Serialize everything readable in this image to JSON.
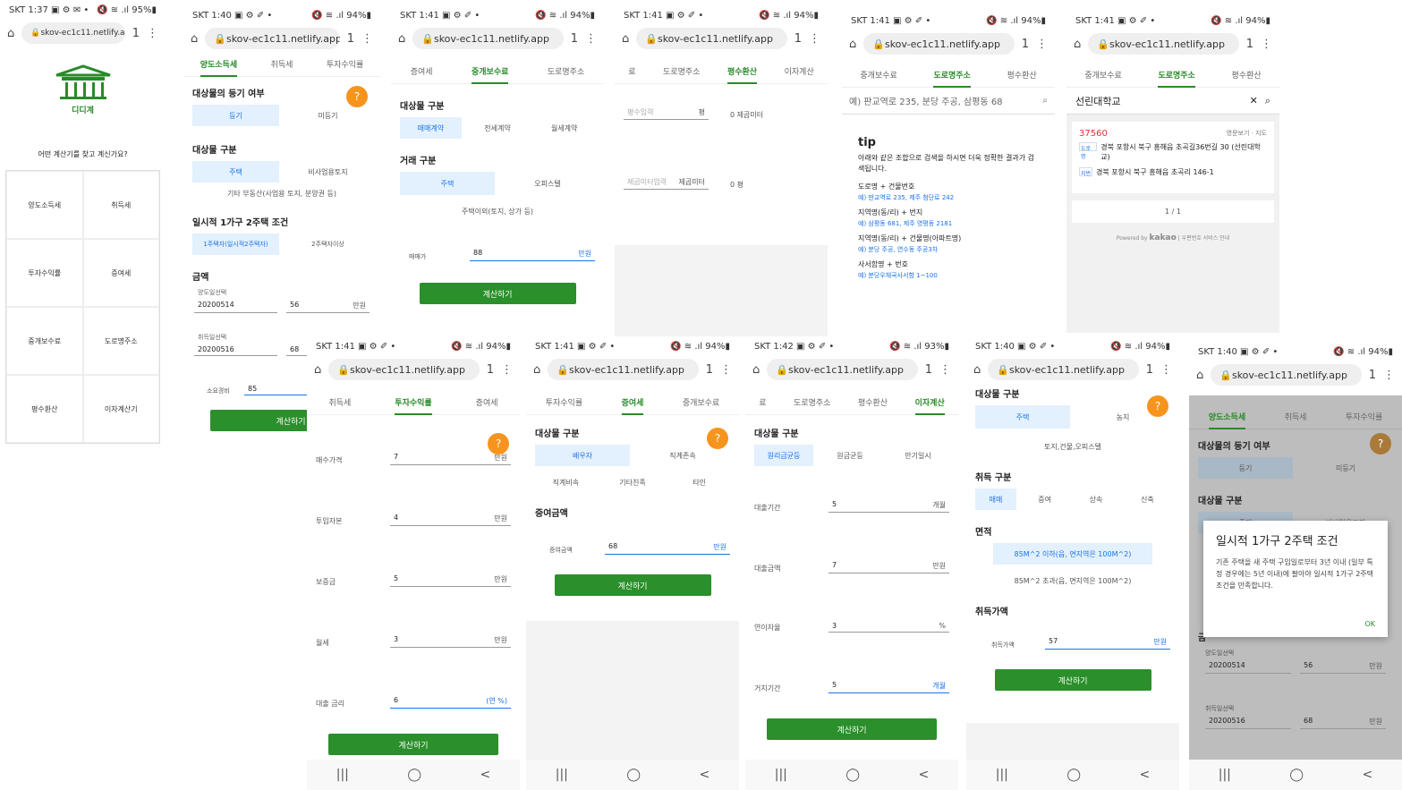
{
  "url": "skov-ec1c11.netlify.app",
  "tab_count": "1",
  "p1": {
    "status": "SKT 1:37 ▣ ⚙ ✉ •",
    "status_r": "🔇 ≋ .ıl 95%▮",
    "logo": "디디계",
    "question": "어떤 계산기를 찾고 계신가요?",
    "menu": [
      "양도소득세",
      "취득세",
      "투자수익률",
      "증여세",
      "중개보수료",
      "도로명주소",
      "평수환산",
      "이자계산기"
    ]
  },
  "p2": {
    "status": "SKT 1:40 ▣ ⚙ ✐ •",
    "status_r": "🔇 ≋ .ıl 94%▮",
    "tabs": [
      "양도소득세",
      "취득세",
      "투자수익률"
    ],
    "s1": "대상물의 등기 여부",
    "o1": [
      "등기",
      "미등기"
    ],
    "s2": "대상물 구분",
    "o2": [
      "주택",
      "비사업용토지"
    ],
    "o2b": "기타 부동산(사업용 토지, 분양권 등)",
    "s3": "일시적 1가구 2주택 조건",
    "o3": [
      "1주택자(일시적2주택자)",
      "2주택자이상"
    ],
    "s4": "금액",
    "l1": "양도일선택",
    "d1": "20200514",
    "v1": "56",
    "u": "만원",
    "l2": "취득일선택",
    "d2": "20200516",
    "v2": "68",
    "l3": "소요경비",
    "v3": "85",
    "btn": "계산하기",
    "fab": "?"
  },
  "p3": {
    "status": "SKT 1:41 ▣ ⚙ ✐ •",
    "status_r": "🔇 ≋ .ıl 94%▮",
    "tabs": [
      "증여세",
      "중개보수료",
      "도로명주소"
    ],
    "s1": "대상물 구분",
    "o1": [
      "매매계약",
      "전세계약",
      "월세계약"
    ],
    "s2": "거래 구분",
    "o2": [
      "주택",
      "오피스텔"
    ],
    "o2b": "주택이외(토지, 상가 등)",
    "l1": "매매가",
    "v1": "88",
    "u": "만원",
    "btn": "계산하기"
  },
  "p4": {
    "status": "SKT 1:41 ▣ ⚙ ✐ •",
    "status_r": "🔇 ≋ .ıl 94%▮",
    "tabs": [
      "료",
      "도로명주소",
      "평수환산",
      "이자계산"
    ],
    "l1": "평수입력",
    "u1": "평",
    "r1": "0 제곱미터",
    "l2": "제곱미터입력",
    "u2": "제곱미터",
    "r2": "0 평"
  },
  "p5": {
    "status": "SKT 1:41 ▣ ⚙ ✐ •",
    "status_r": "🔇 ≋ .ıl 94%▮",
    "tabs": [
      "중개보수료",
      "도로명주소",
      "평수환산"
    ],
    "search": "예) 판교역로 235, 분당 주공, 삼평동 68",
    "tip": "tip",
    "desc": "아래와 같은 조합으로 검색을 하시면 더욱 정확한 결과가 검색됩니다.",
    "items": [
      [
        "도로명 + 건물번호",
        "예) 판교역로 235, 제주 첨단로 242"
      ],
      [
        "지역명(동/리) + 번지",
        "예) 삼평동 681, 제주 영평동 2181"
      ],
      [
        "지역명(동/리) + 건물명(아파트명)",
        "예) 분당 주공, 연수동 주공3차"
      ],
      [
        "사서함명 + 번호",
        "예) 분당우체국사서함 1~100"
      ]
    ]
  },
  "p6": {
    "status": "SKT 1:41 ▣ ⚙ ✐ •",
    "status_r": "🔇 ≋ .ıl 94%▮",
    "tabs": [
      "중개보수료",
      "도로명주소",
      "평수환산"
    ],
    "query": "선린대학교",
    "zip": "37560",
    "links": "영문보기 · 지도",
    "tag1": "도로명",
    "addr1": "경북 포항시 북구 흥해읍 초곡길36번길 30 (선린대학교)",
    "tag2": "지번",
    "addr2": "경북 포항시 북구 흥해읍 초곡리 146-1",
    "page": "1 / 1",
    "powered": "Powered by",
    "kakao": "kakao",
    "guide": "우편번호 서비스 안내"
  },
  "p7": {
    "status": "SKT 1:41 ▣ ⚙ ✐ •",
    "status_r": "🔇 ≋ .ıl 94%▮",
    "tabs": [
      "취득세",
      "투자수익률",
      "증여세"
    ],
    "rows": [
      [
        "매수가격",
        "7",
        "만원"
      ],
      [
        "투입자본",
        "4",
        "만원"
      ],
      [
        "보증금",
        "5",
        "만원"
      ],
      [
        "월세",
        "3",
        "만원"
      ],
      [
        "대출 금리",
        "6",
        "(연 %)"
      ]
    ],
    "btn": "계산하기",
    "fab": "?"
  },
  "p8": {
    "status": "SKT 1:41 ▣ ⚙ ✐ •",
    "status_r": "🔇 ≋ .ıl 94%▮",
    "tabs": [
      "투자수익률",
      "증여세",
      "중개보수료"
    ],
    "s1": "대상물 구분",
    "o1": [
      "배우자",
      "직계존속"
    ],
    "o1b": [
      "직계비속",
      "기타친족",
      "타인"
    ],
    "s2": "증여금액",
    "l1": "증여금액",
    "v1": "68",
    "u": "만원",
    "btn": "계산하기",
    "fab": "?"
  },
  "p9": {
    "status": "SKT 1:42 ▣ ⚙ ✐ •",
    "status_r": "🔇 ≋ .ıl 93%▮",
    "tabs": [
      "료",
      "도로명주소",
      "평수환산",
      "이자계산"
    ],
    "s1": "대상물 구분",
    "o1": [
      "원리금균등",
      "원금균등",
      "만기일시"
    ],
    "rows": [
      [
        "대출기간",
        "5",
        "개월"
      ],
      [
        "대출금액",
        "7",
        "만원"
      ],
      [
        "연이자율",
        "3",
        "%"
      ],
      [
        "거치기간",
        "5",
        "개월"
      ]
    ],
    "btn": "계산하기"
  },
  "p10": {
    "status": "SKT 1:40 ▣ ⚙ ✐ •",
    "status_r": "🔇 ≋ .ıl 94%▮",
    "s1": "대상물 구분",
    "o1": [
      "주택",
      "농지"
    ],
    "o1b": "토지,건물,오피스텔",
    "s2": "취득 구분",
    "o2": [
      "매매",
      "증여",
      "상속",
      "신축"
    ],
    "s3": "면적",
    "o3a": "85M^2 이하(읍, 면지역은 100M^2)",
    "o3b": "85M^2 초과(읍, 면지역은 100M^2)",
    "s4": "취득가액",
    "l1": "취득가액",
    "v1": "57",
    "u": "만원",
    "btn": "계산하기",
    "fab": "?"
  },
  "p11": {
    "status": "SKT 1:40 ▣ ⚙ ✐ •",
    "status_r": "🔇 ≋ .ıl 94%▮",
    "tabs": [
      "양도소득세",
      "취득세",
      "투자수익률"
    ],
    "s1": "대상물의 등기 여부",
    "o1": [
      "등기",
      "미등기"
    ],
    "s2": "대상물 구분",
    "o2": [
      "주택",
      "비사업용토지"
    ],
    "dlg_title": "일시적 1가구 2주택 조건",
    "dlg_body": "기존 주택을 새 주택 구입일로부터 3년 이내 (일부 특정 경우에는 5년 이내)에 팔아야 일시적 1가구 2주택 조건을 만족합니다.",
    "ok": "OK",
    "g": "금",
    "l1": "양도일선택",
    "d1": "20200514",
    "v1": "56",
    "u": "만원",
    "l2": "취득일선택",
    "d2": "20200516",
    "v2": "68"
  },
  "nav": [
    "|||",
    "◯",
    "<"
  ]
}
